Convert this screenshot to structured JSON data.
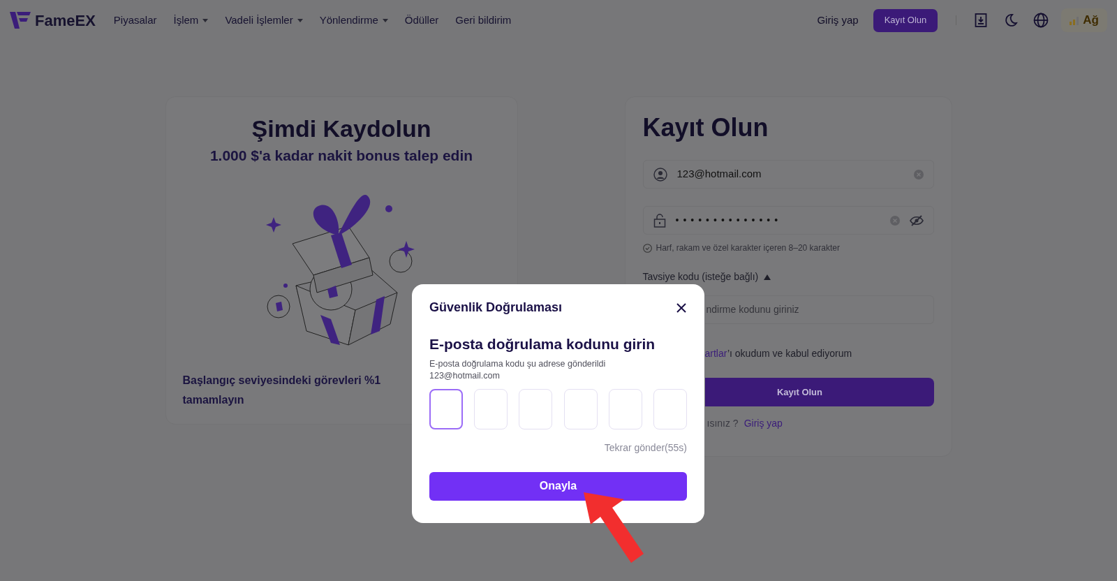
{
  "nav": {
    "logo": "FameEX",
    "menu": [
      {
        "label": "Piyasalar",
        "dropdown": false
      },
      {
        "label": "İşlem",
        "dropdown": true
      },
      {
        "label": "Vadeli İşlemler",
        "dropdown": true
      },
      {
        "label": "Yönlendirme",
        "dropdown": true
      },
      {
        "label": "Ödüller",
        "dropdown": false
      },
      {
        "label": "Geri bildirim",
        "dropdown": false
      }
    ],
    "login": "Giriş yap",
    "signup": "Kayıt Olun",
    "network": "Ağ"
  },
  "promo": {
    "title": "Şimdi Kaydolun",
    "subtitle": "1.000 $'a kadar nakit bonus talep edin",
    "description_lines": [
      "Başlangıç seviyesindeki görevleri %1",
      "tamamlayın"
    ]
  },
  "register": {
    "title": "Kayıt Olun",
    "email": {
      "value": "123@hotmail.com"
    },
    "password": {
      "value": "••••••••••••••"
    },
    "password_hint": "Harf, rakam ve özel karakter içeren 8–20 karakter",
    "referral": {
      "label": "Tavsiye kodu (isteğe bağlı)",
      "expanded": true,
      "placeholder": "ndirme kodunu giriniz"
    },
    "terms": {
      "link": "artlar",
      "text": "’ı okudum ve kabul ediyorum"
    },
    "submit": "Kayıt Olun",
    "login_prompt": {
      "text": "ısınız ?",
      "link": "Giriş yap"
    }
  },
  "dialog": {
    "title": "Güvenlik Doğrulaması",
    "heading": "E-posta doğrulama kodunu girin",
    "sent_to": "E-posta doğrulama kodu şu adrese gönderildi",
    "email": "123@hotmail.com",
    "code_boxes": [
      {
        "focused": true
      },
      {
        "focused": false
      },
      {
        "focused": false
      },
      {
        "focused": false
      },
      {
        "focused": false
      },
      {
        "focused": false
      }
    ],
    "resend": "Tekrar gönder(55s)",
    "confirm": "Onayla"
  }
}
